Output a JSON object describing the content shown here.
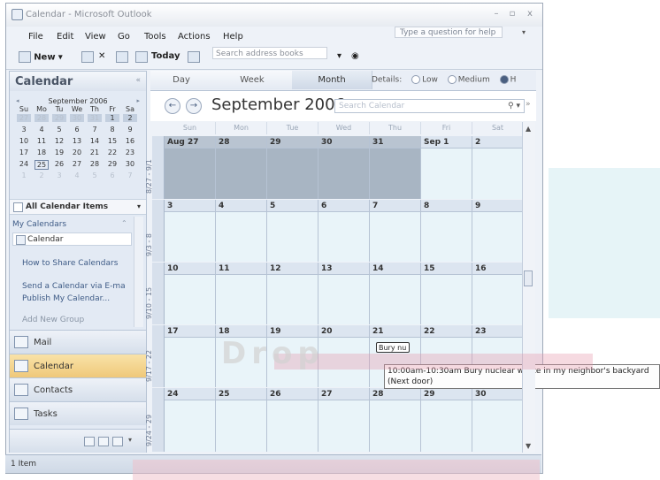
{
  "window": {
    "title": "Calendar - Microsoft Outlook",
    "min": "–",
    "max": "▫",
    "close": "x"
  },
  "menu": [
    "File",
    "Edit",
    "View",
    "Go",
    "Tools",
    "Actions",
    "Help"
  ],
  "help_placeholder": "Type a question for help",
  "toolbar": {
    "new_label": "New",
    "today_label": "Today",
    "address_placeholder": "Search address books"
  },
  "nav": {
    "title": "Calendar",
    "mini_cal": {
      "month_label": "September 2006",
      "dow": [
        "Su",
        "Mo",
        "Tu",
        "We",
        "Th",
        "Fr",
        "Sa"
      ],
      "weeks": [
        [
          "27",
          "28",
          "29",
          "30",
          "31",
          "1",
          "2"
        ],
        [
          "3",
          "4",
          "5",
          "6",
          "7",
          "8",
          "9"
        ],
        [
          "10",
          "11",
          "12",
          "13",
          "14",
          "15",
          "16"
        ],
        [
          "17",
          "18",
          "19",
          "20",
          "21",
          "22",
          "23"
        ],
        [
          "24",
          "25",
          "26",
          "27",
          "28",
          "29",
          "30"
        ],
        [
          "1",
          "2",
          "3",
          "4",
          "5",
          "6",
          "7"
        ]
      ]
    },
    "all_calendar_items": "All Calendar Items",
    "my_calendars": "My Calendars",
    "calendar_item": "Calendar",
    "links": [
      "How to Share Calendars",
      "Send a Calendar via E-ma",
      "Publish My Calendar...",
      "Add New Group"
    ],
    "buttons": [
      {
        "label": "Mail",
        "icon": "mail-icon"
      },
      {
        "label": "Calendar",
        "icon": "calendar-icon"
      },
      {
        "label": "Contacts",
        "icon": "contacts-icon"
      },
      {
        "label": "Tasks",
        "icon": "tasks-icon"
      }
    ]
  },
  "view_tabs": [
    "Day",
    "Week",
    "Month"
  ],
  "details": {
    "label": "Details:",
    "low": "Low",
    "medium": "Medium",
    "high": "H"
  },
  "cal_header": {
    "month_title": "September 2006",
    "search_placeholder": "Search Calendar"
  },
  "dow_header": [
    "Sun",
    "Mon",
    "Tue",
    "Wed",
    "Thu",
    "Fri",
    "Sat"
  ],
  "weeks": [
    {
      "label": "8/27 - 9/1",
      "days": [
        "Aug 27",
        "28",
        "29",
        "30",
        "31",
        "Sep 1",
        "2"
      ]
    },
    {
      "label": "9/3 - 8",
      "days": [
        "3",
        "4",
        "5",
        "6",
        "7",
        "8",
        "9"
      ]
    },
    {
      "label": "9/10 - 15",
      "days": [
        "10",
        "11",
        "12",
        "13",
        "14",
        "15",
        "16"
      ]
    },
    {
      "label": "9/17 - 22",
      "days": [
        "17",
        "18",
        "19",
        "20",
        "21",
        "22",
        "23"
      ]
    },
    {
      "label": "9/24 - 29",
      "days": [
        "24",
        "25",
        "26",
        "27",
        "28",
        "29",
        "30"
      ]
    }
  ],
  "appointment": {
    "short": "Bury nu",
    "tooltip_line1": "10:00am-10:30am Bury nuclear waste in my neighbor's backyard",
    "tooltip_line2": "(Next door)"
  },
  "status": {
    "items": "1 Item"
  },
  "watermark": "Drop"
}
